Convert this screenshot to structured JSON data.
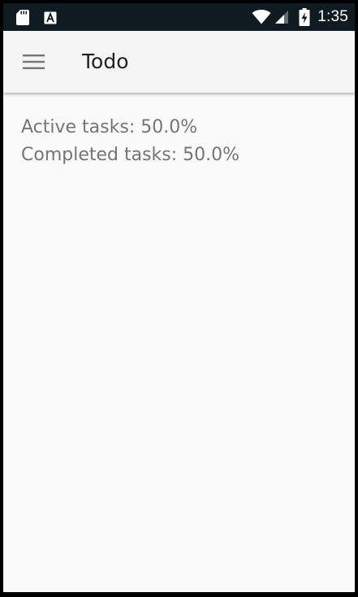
{
  "status_bar": {
    "time": "1:35",
    "icons": [
      "sd-card-icon",
      "a-keyboard-icon",
      "wifi-icon",
      "cellular-signal-icon",
      "battery-charging-icon"
    ]
  },
  "app_bar": {
    "title": "Todo",
    "nav_icon": "menu-icon"
  },
  "statistics": {
    "active_tasks": "Active tasks: 50.0%",
    "completed_tasks": "Completed tasks: 50.0%"
  },
  "colors": {
    "status_bar_bg": "#0f1b20",
    "app_bar_bg": "#f5f5f5",
    "content_bg": "#fafafa",
    "title_text": "#212121",
    "stat_text": "#757575"
  }
}
